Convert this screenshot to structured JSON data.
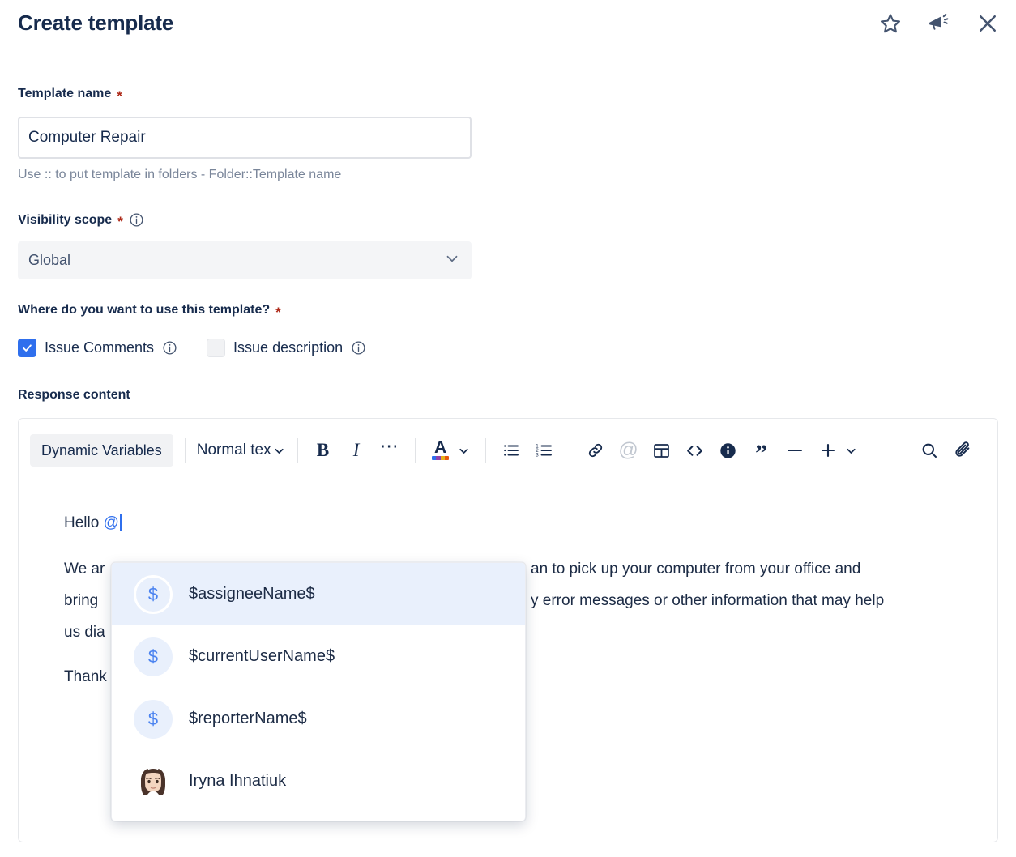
{
  "header": {
    "title": "Create template",
    "icons": [
      {
        "name": "favorite-star-icon",
        "label": "Favorite"
      },
      {
        "name": "announcement-megaphone-icon",
        "label": "Announcements"
      },
      {
        "name": "close-icon",
        "label": "Close"
      }
    ]
  },
  "form": {
    "template_name": {
      "label": "Template name",
      "required_marker": "*",
      "value": "Computer Repair",
      "placeholder": "",
      "hint": "Use :: to put template in folders - Folder::Template name"
    },
    "visibility_scope": {
      "label": "Visibility scope",
      "required_marker": "*",
      "value": "Global",
      "options": [
        "Global"
      ]
    },
    "where_use": {
      "label": "Where do you want to use this template?",
      "required_marker": "*",
      "options": [
        {
          "label": "Issue Comments",
          "checked": true
        },
        {
          "label": "Issue description",
          "checked": false
        }
      ]
    },
    "response_content": {
      "label": "Response content"
    }
  },
  "editor": {
    "toolbar": {
      "dynamic_variables": "Dynamic Variables",
      "text_style": "Normal tex",
      "buttons": [
        {
          "name": "bold-icon",
          "label": "B"
        },
        {
          "name": "italic-icon",
          "label": "I"
        },
        {
          "name": "more-formatting-icon",
          "label": "•••"
        },
        {
          "name": "text-color-icon",
          "label": "A"
        },
        {
          "name": "bullet-list-icon",
          "label": "Bullet list"
        },
        {
          "name": "numbered-list-icon",
          "label": "Numbered list"
        },
        {
          "name": "link-icon",
          "label": "Link"
        },
        {
          "name": "mention-icon",
          "label": "@"
        },
        {
          "name": "table-icon",
          "label": "Table"
        },
        {
          "name": "code-block-icon",
          "label": "<>"
        },
        {
          "name": "info-panel-icon",
          "label": "Info panel"
        },
        {
          "name": "quote-icon",
          "label": "Quote"
        },
        {
          "name": "divider-icon",
          "label": "Divider"
        },
        {
          "name": "insert-more-icon",
          "label": "+"
        },
        {
          "name": "search-icon",
          "label": "Search"
        },
        {
          "name": "attachment-icon",
          "label": "Attach"
        }
      ],
      "colors": [
        "#2f6fed",
        "#8e44ad",
        "#e8b21a",
        "#e8590c"
      ]
    },
    "content": {
      "line1_prefix": "Hello ",
      "line1_mention": "@",
      "line2": "We ar",
      "line2_tail": "an to pick up your computer from your office and",
      "line3": "bring",
      "line3_tail": "y error messages or other information that may help",
      "line4": "us dia",
      "line5": "Thank"
    }
  },
  "mention_dropdown": {
    "items": [
      {
        "label": "$assigneeName$",
        "avatar": "dollar-avatar",
        "glyph": "$",
        "selected": true
      },
      {
        "label": "$currentUserName$",
        "avatar": "dollar-avatar",
        "glyph": "$",
        "selected": false
      },
      {
        "label": "$reporterName$",
        "avatar": "dollar-avatar",
        "glyph": "$",
        "selected": false
      },
      {
        "label": "Iryna Ihnatiuk",
        "avatar": "user-photo-avatar",
        "glyph": "",
        "selected": false
      }
    ]
  },
  "colors": {
    "accent_blue": "#2f6fed",
    "text_dark": "#172b4d",
    "muted": "#7a869a",
    "required_red": "#ae2a19",
    "selected_row": "#e9f0fc"
  }
}
